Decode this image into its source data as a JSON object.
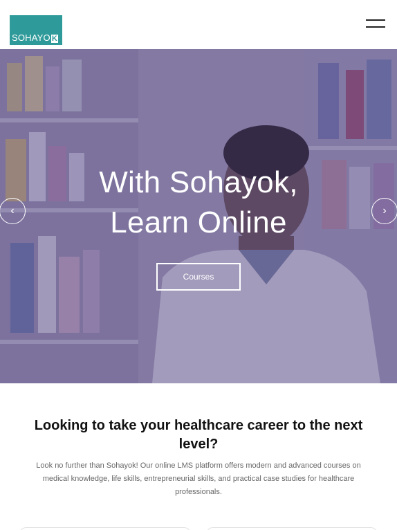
{
  "header": {
    "logo_text": "SOHAYO",
    "logo_letter": "K"
  },
  "hero": {
    "title_line1": "With Sohayok,",
    "title_line2": "Learn Online",
    "button_label": "Courses",
    "prev_arrow": "‹",
    "next_arrow": "›"
  },
  "intro": {
    "heading": "Looking to take your healthcare career to the next level?",
    "text": "Look no further than Sohayok! Our online LMS platform offers modern and advanced courses on medical knowledge, life skills, entrepreneurial skills, and practical case studies for healthcare professionals."
  },
  "colors": {
    "brand": "#2f9a9a",
    "hero_overlay": "#483878"
  }
}
